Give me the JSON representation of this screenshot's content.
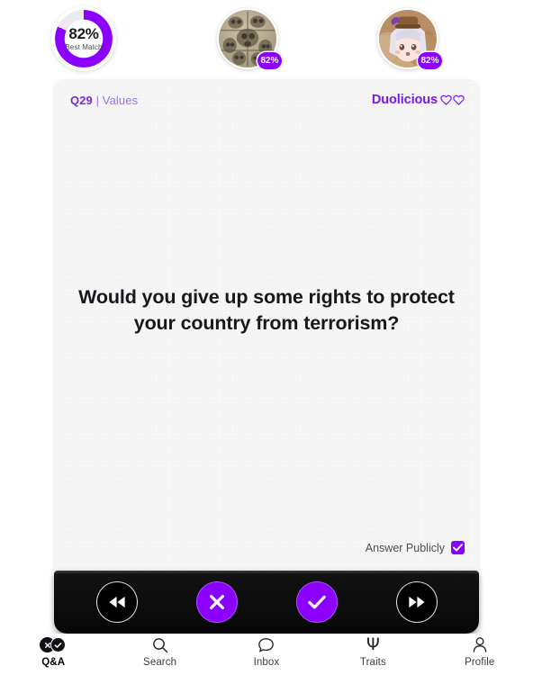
{
  "theme": {
    "accent_purple": "#8b00ff",
    "brand_purple": "#7b16f0",
    "meta_purple": "#9d6ef0",
    "card_bg": "#f6f5f6",
    "action_bar_bg": "#0b0b0b",
    "page_bg": "#ffffff"
  },
  "top_strip": {
    "best_match": {
      "percent_label": "82%",
      "caption": "Best Match",
      "percent_value": 82,
      "icon": "donut-progress-ring"
    },
    "matches": [
      {
        "name": "match-avatar-1",
        "badge": "82%",
        "badge_value": 82,
        "image_kind": "sepia-carved-stone-photo"
      },
      {
        "name": "match-avatar-2",
        "badge": "82%",
        "badge_value": 82,
        "image_kind": "anime-character-illustration"
      }
    ]
  },
  "card": {
    "meta_prefix": "Q",
    "meta_number": "29",
    "meta_separator": " | ",
    "meta_category": "Values",
    "meta_full": "Q29 | Values",
    "brand_name": "Duolicious",
    "brand_icons": [
      "heart-outline-icon",
      "heart-outline-icon"
    ],
    "question": "Would you give up some rights to protect your country from terrorism?",
    "answer_publicly": {
      "label": "Answer Publicly",
      "checked": true,
      "icon": "checkmark-icon"
    }
  },
  "action_bar": {
    "buttons": [
      {
        "name": "skip-back-button",
        "icon": "rewind-icon",
        "style": "dark",
        "label": "Rewind"
      },
      {
        "name": "answer-no-button",
        "icon": "close-x-icon",
        "style": "purple",
        "label": "No"
      },
      {
        "name": "answer-yes-button",
        "icon": "checkmark-icon",
        "style": "purple",
        "label": "Yes"
      },
      {
        "name": "skip-forward-button",
        "icon": "fast-forward-icon",
        "style": "dark",
        "label": "Skip"
      }
    ]
  },
  "bottom_nav": {
    "items": [
      {
        "label": "Q&A",
        "icon": "qa-circles-icon",
        "active": true
      },
      {
        "label": "Search",
        "icon": "search-icon",
        "active": false
      },
      {
        "label": "Inbox",
        "icon": "chat-bubble-icon",
        "active": false
      },
      {
        "label": "Traits",
        "icon": "psi-icon",
        "active": false
      },
      {
        "label": "Profile",
        "icon": "person-icon",
        "active": false
      }
    ],
    "psi_glyph": "Ψ"
  }
}
